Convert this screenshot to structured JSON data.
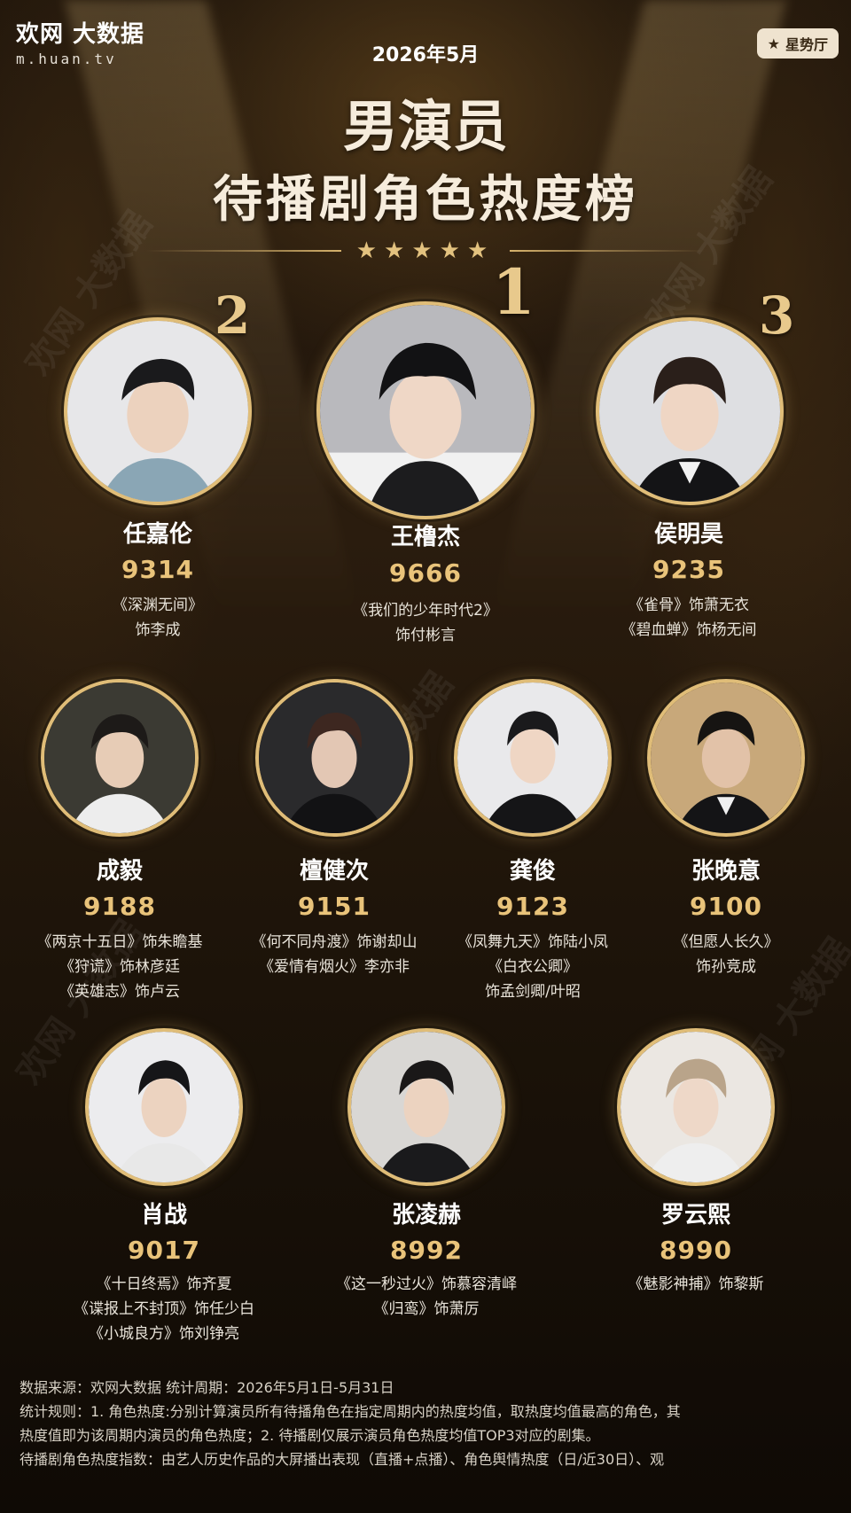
{
  "header": {
    "brand": "欢网 大数据",
    "url": "m.huan.tv",
    "badge": "星势厅",
    "date": "2026年5月",
    "title_line1": "男演员",
    "title_line2": "待播剧角色热度榜",
    "stars": "★★★★★"
  },
  "top3": [
    {
      "rank": "1",
      "name": "王橹杰",
      "score": "9666",
      "roles": [
        "《我们的少年时代2》",
        "饰付彬言"
      ]
    },
    {
      "rank": "2",
      "name": "任嘉伦",
      "score": "9314",
      "roles": [
        "《深渊无间》",
        "饰李成"
      ]
    },
    {
      "rank": "3",
      "name": "侯明昊",
      "score": "9235",
      "roles": [
        "《雀骨》饰萧无衣",
        "《碧血蝉》饰杨无间"
      ]
    }
  ],
  "row2": [
    {
      "name": "成毅",
      "score": "9188",
      "roles": [
        "《两京十五日》饰朱瞻基",
        "《狩谎》饰林彦廷",
        "《英雄志》饰卢云"
      ]
    },
    {
      "name": "檀健次",
      "score": "9151",
      "roles": [
        "《何不同舟渡》饰谢却山",
        "《爱情有烟火》李亦非"
      ]
    },
    {
      "name": "龚俊",
      "score": "9123",
      "roles": [
        "《凤舞九天》饰陆小凤",
        "《白衣公卿》",
        "饰孟剑卿/叶昭"
      ]
    },
    {
      "name": "张晚意",
      "score": "9100",
      "roles": [
        "《但愿人长久》",
        "饰孙竞成"
      ]
    }
  ],
  "row3": [
    {
      "name": "肖战",
      "score": "9017",
      "roles": [
        "《十日终焉》饰齐夏",
        "《谍报上不封顶》饰任少白",
        "《小城良方》饰刘铮亮"
      ]
    },
    {
      "name": "张凌赫",
      "score": "8992",
      "roles": [
        "《这一秒过火》饰慕容清峄",
        "《归鸾》饰萧厉"
      ]
    },
    {
      "name": "罗云熙",
      "score": "8990",
      "roles": [
        "《魅影神捕》饰黎斯"
      ]
    }
  ],
  "footer": {
    "line1": "数据来源：欢网大数据    统计周期：2026年5月1日-5月31日",
    "line2": "统计规则：1. 角色热度:分别计算演员所有待播角色在指定周期内的热度均值，取热度均值最高的角色，其",
    "line3": "热度值即为该周期内演员的角色热度；2. 待播剧仅展示演员角色热度均值TOP3对应的剧集。",
    "line4": "待播剧角色热度指数：由艺人历史作品的大屏播出表现（直播+点播）、角色舆情热度（日/近30日）、观"
  },
  "colors": {
    "gold": "#e0bd78",
    "score": "#e9c37a",
    "bg": "#1b120a"
  }
}
